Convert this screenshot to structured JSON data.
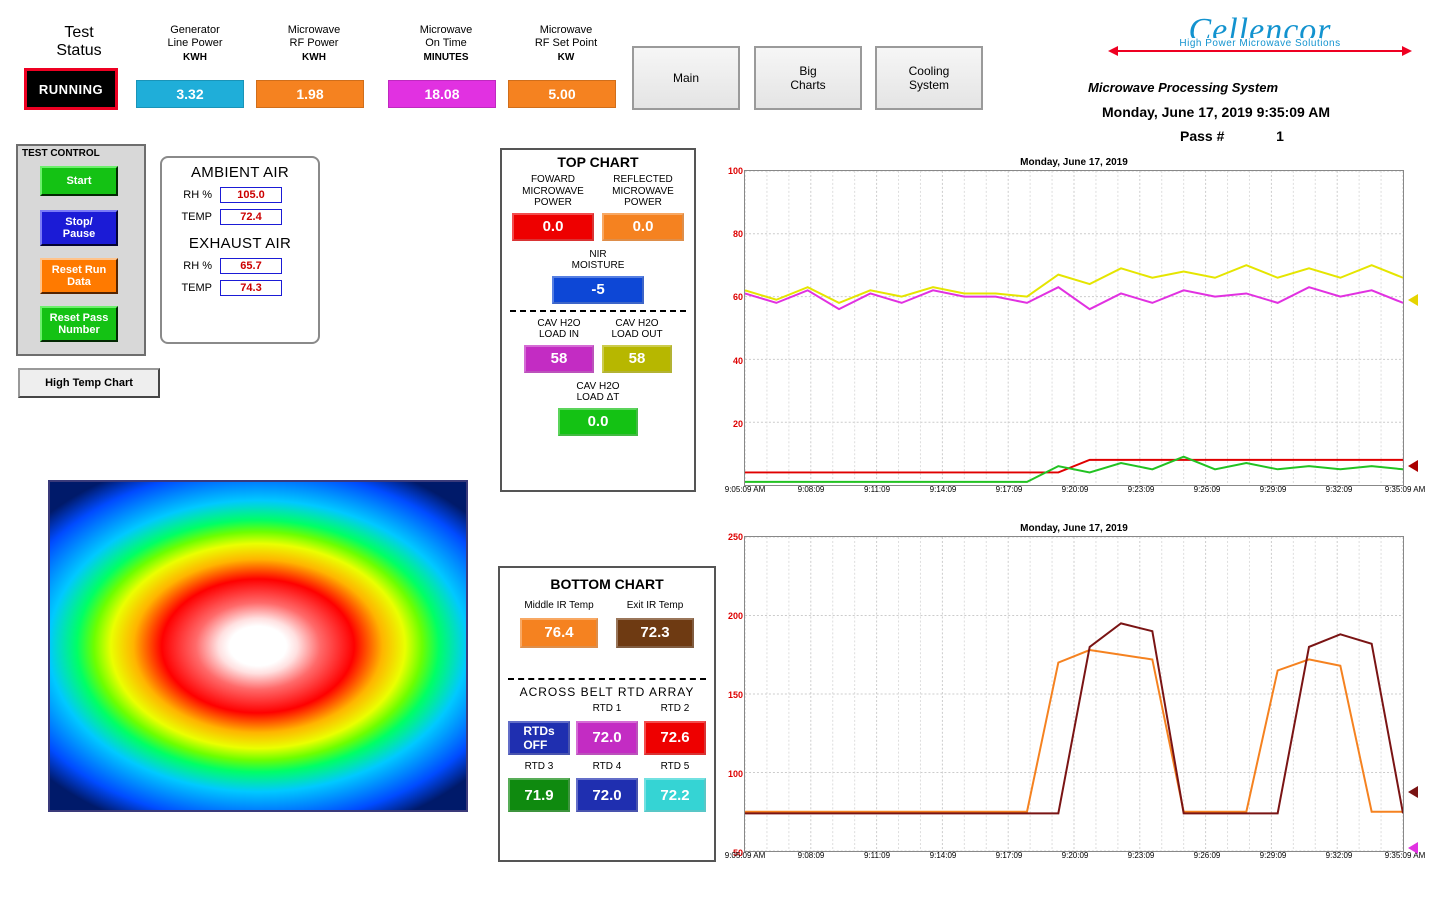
{
  "status": {
    "title": "Test\nStatus",
    "value": "RUNNING"
  },
  "kpis": {
    "gen": {
      "title": "Generator\nLine Power",
      "units": "KWH",
      "value": "3.32"
    },
    "rfpwr": {
      "title": "Microwave\nRF Power",
      "units": "KWH",
      "value": "1.98"
    },
    "ontime": {
      "title": "Microwave\nOn Time",
      "units": "MINUTES",
      "value": "18.08"
    },
    "setpt": {
      "title": "Microwave\nRF Set Point",
      "units": "KW",
      "value": "5.00"
    }
  },
  "nav": {
    "main": "Main",
    "big": "Big\nCharts",
    "cool": "Cooling\nSystem"
  },
  "brand": {
    "name": "Cellencor",
    "tag": "High Power Microwave Solutions",
    "system": "Microwave Processing System",
    "datetime": "Monday, June 17, 2019 9:35:09 AM",
    "pass_label": "Pass #",
    "pass_value": "1"
  },
  "test_control": {
    "title": "TEST CONTROL",
    "start": "Start",
    "stop": "Stop/\nPause",
    "reset_run": "Reset Run\nData",
    "reset_pass": "Reset Pass\nNumber",
    "high_temp": "High Temp Chart"
  },
  "air": {
    "amb_h": "AMBIENT AIR",
    "exh_h": "EXHAUST AIR",
    "rh_lbl": "RH %",
    "t_lbl": "TEMP",
    "amb_rh": "105.0",
    "amb_t": "72.4",
    "exh_rh": "65.7",
    "exh_t": "74.3"
  },
  "top_chart_ctrl": {
    "title": "TOP CHART",
    "fwd_lbl": "FOWARD\nMICROWAVE\nPOWER",
    "ref_lbl": "REFLECTED\nMICROWAVE\nPOWER",
    "fwd": "0.0",
    "ref": "0.0",
    "nir_lbl": "NIR\nMOISTURE",
    "nir": "-5",
    "cav_in_lbl": "CAV H2O\nLOAD IN",
    "cav_out_lbl": "CAV H2O\nLOAD OUT",
    "cav_in": "58",
    "cav_out": "58",
    "cav_dt_lbl": "CAV H2O\nLOAD ΔT",
    "cav_dt": "0.0"
  },
  "bottom_chart_ctrl": {
    "title": "BOTTOM CHART",
    "mid_lbl": "Middle IR Temp",
    "exit_lbl": "Exit IR Temp",
    "mid": "76.4",
    "exit": "72.3",
    "rtd_h": "ACROSS BELT RTD ARRAY",
    "rtds_off": "RTDs\nOFF",
    "rtd1_l": "RTD 1",
    "rtd1": "72.0",
    "rtd2_l": "RTD 2",
    "rtd2": "72.6",
    "rtd3_l": "RTD 3",
    "rtd3": "71.9",
    "rtd4_l": "RTD 4",
    "rtd4": "72.0",
    "rtd5_l": "RTD 5",
    "rtd5": "72.2"
  },
  "chart_shared": {
    "title": "Monday, June 17, 2019",
    "x_times": [
      "9:05:09 AM",
      "9:08:09",
      "9:11:09",
      "9:14:09",
      "9:17:09",
      "9:20:09",
      "9:23:09",
      "9:26:09",
      "9:29:09",
      "9:32:09",
      "9:35:09 AM"
    ]
  },
  "chart_data": [
    {
      "type": "line",
      "title": "Monday, June 17, 2019",
      "ylim": [
        0,
        100
      ],
      "yticks": [
        20,
        40,
        60,
        80,
        100
      ],
      "x": [
        "9:05",
        "9:08",
        "9:11",
        "9:14",
        "9:17",
        "9:20",
        "9:23",
        "9:26",
        "9:29",
        "9:32",
        "9:35"
      ],
      "xlabel": "",
      "ylabel": "",
      "series": [
        {
          "name": "CAV H2O LOAD IN",
          "color": "#e131e1",
          "values": [
            61,
            58,
            62,
            56,
            61,
            58,
            62,
            60,
            60,
            58,
            63,
            56,
            61,
            58,
            62,
            60,
            61,
            58,
            63,
            60,
            62,
            58
          ]
        },
        {
          "name": "CAV H2O LOAD OUT",
          "color": "#e5e500",
          "values": [
            62,
            59,
            63,
            58,
            62,
            60,
            63,
            61,
            61,
            60,
            67,
            64,
            69,
            66,
            68,
            66,
            70,
            66,
            69,
            66,
            70,
            66
          ]
        },
        {
          "name": "FWD MW POWER",
          "color": "#e00000",
          "values": [
            4,
            4,
            4,
            4,
            4,
            4,
            4,
            4,
            4,
            4,
            4,
            8,
            8,
            8,
            8,
            8,
            8,
            8,
            8,
            8,
            8,
            8
          ]
        },
        {
          "name": "REFL MW POWER",
          "color": "#22c222",
          "values": [
            1,
            1,
            1,
            1,
            1,
            1,
            1,
            1,
            1,
            1,
            6,
            4,
            7,
            5,
            9,
            5,
            7,
            5,
            6,
            5,
            6,
            5
          ]
        }
      ]
    },
    {
      "type": "line",
      "title": "Monday, June 17, 2019",
      "ylim": [
        50,
        250
      ],
      "yticks": [
        50,
        100,
        150,
        200,
        250
      ],
      "x": [
        "9:05",
        "9:08",
        "9:11",
        "9:14",
        "9:17",
        "9:20",
        "9:23",
        "9:26",
        "9:29",
        "9:32",
        "9:35"
      ],
      "xlabel": "",
      "ylabel": "",
      "series": [
        {
          "name": "Middle IR Temp",
          "color": "#f58220",
          "values": [
            75,
            75,
            75,
            75,
            75,
            75,
            75,
            75,
            75,
            75,
            170,
            178,
            175,
            172,
            75,
            75,
            75,
            165,
            172,
            168,
            75,
            75
          ]
        },
        {
          "name": "Exit IR Temp",
          "color": "#7a1414",
          "values": [
            74,
            74,
            74,
            74,
            74,
            74,
            74,
            74,
            74,
            74,
            74,
            180,
            195,
            190,
            74,
            74,
            74,
            74,
            180,
            188,
            182,
            74
          ]
        }
      ]
    }
  ]
}
